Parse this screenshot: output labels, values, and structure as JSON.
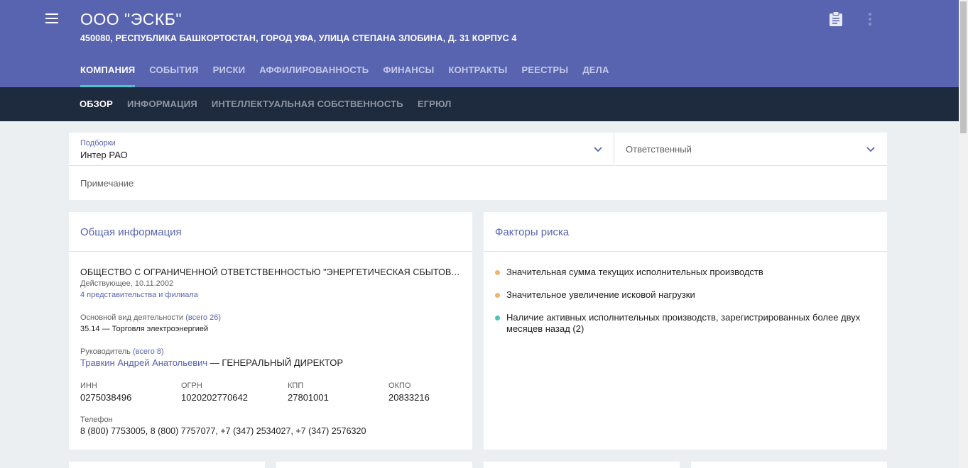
{
  "header": {
    "title": "ООО \"ЭСКБ\"",
    "address": "450080, РЕСПУБЛИКА БАШКОРТОСТАН, ГОРОД УФА, УЛИЦА СТЕПАНА ЗЛОБИНА, Д. 31 КОРПУС 4",
    "icons": [
      "menu-icon",
      "clipboard-icon",
      "more-vert-icon"
    ]
  },
  "tabs": [
    {
      "label": "КОМПАНИЯ",
      "active": true
    },
    {
      "label": "СОБЫТИЯ"
    },
    {
      "label": "РИСКИ"
    },
    {
      "label": "АФФИЛИРОВАННОСТЬ"
    },
    {
      "label": "ФИНАНСЫ"
    },
    {
      "label": "КОНТРАКТЫ"
    },
    {
      "label": "РЕЕСТРЫ"
    },
    {
      "label": "ДЕЛА"
    }
  ],
  "subtabs": [
    {
      "label": "ОБЗОР",
      "active": true
    },
    {
      "label": "ИНФОРМАЦИЯ"
    },
    {
      "label": "ИНТЕЛЛЕКТУАЛЬНАЯ СОБСТВЕННОСТЬ"
    },
    {
      "label": "ЕГРЮЛ"
    }
  ],
  "filters": {
    "podborki_label": "Подборки",
    "podborki_value": "Интер РАО",
    "responsible_label": "Ответственный",
    "note_label": "Примечание"
  },
  "general": {
    "title": "Общая информация",
    "full_name": "ОБЩЕСТВО С ОГРАНИЧЕННОЙ ОТВЕТСТВЕННОСТЬЮ \"ЭНЕРГЕТИЧЕСКАЯ СБЫТОВАЯ КОМПАНИЯ БАШКОРТОСТАНА\"",
    "status": "Действующее, 10.11.2002",
    "branches": "4 представительства и филиала",
    "activity_label": "Основной вид деятельности",
    "activity_total": "(всего 26)",
    "activity_value": "35.14 — Торговля электроэнергией",
    "head_label": "Руководитель",
    "head_total": "(всего 8)",
    "head_name": "Травкин Андрей Анатольевич",
    "head_position": " — ГЕНЕРАЛЬНЫЙ ДИРЕКТОР",
    "inn_label": "ИНН",
    "inn": "0275038496",
    "ogrn_label": "ОГРН",
    "ogrn": "1020202770642",
    "kpp_label": "КПП",
    "kpp": "27801001",
    "okpo_label": "ОКПО",
    "okpo": "20833216",
    "phone_label": "Телефон",
    "phone": "8 (800) 7753005, 8 (800) 7757077, +7 (347) 2534027, +7 (347) 2576320"
  },
  "risks": {
    "title": "Факторы риска",
    "items": [
      {
        "text": "Значительная сумма текущих исполнительных производств",
        "color": "#f0b46e"
      },
      {
        "text": "Значительное увеличение исковой нагрузки",
        "color": "#f0b46e"
      },
      {
        "text": "Наличие активных исполнительных производств, зарегистрированных более двух месяцев назад (2)",
        "color": "#4dc2b8"
      }
    ]
  },
  "colors": {
    "primary": "#5864b0",
    "dark": "#1e2a3d",
    "accent": "#4fc3c8"
  }
}
